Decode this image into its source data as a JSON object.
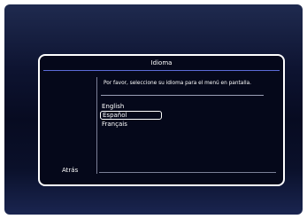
{
  "dialog": {
    "title": "Idioma",
    "prompt": "Por favor, seleccione su idioma para el menú en pantalla.",
    "back_label": "Atrás",
    "languages": [
      "English",
      "Español",
      "Français"
    ],
    "selected_language": "Español"
  },
  "colors": {
    "accent_rule": "#5b6bd6",
    "text": "#ffffff",
    "dialog_border": "#ffffff"
  }
}
